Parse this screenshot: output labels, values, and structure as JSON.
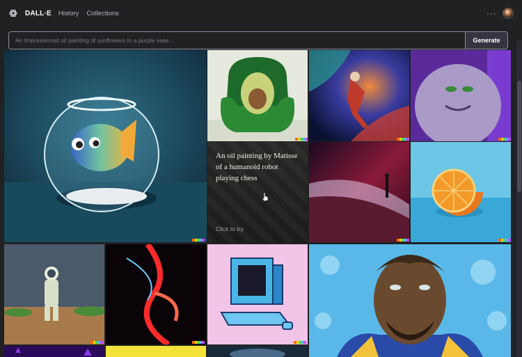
{
  "header": {
    "brand": "DALL·E",
    "nav": [
      {
        "label": "History"
      },
      {
        "label": "Collections"
      }
    ],
    "more_label": "···"
  },
  "search": {
    "placeholder": "An Impressionist oil painting of sunflowers in a purple vase…",
    "button_label": "Generate"
  },
  "prompt_card": {
    "text": "An oil painting by Matisse of a humanoid robot playing chess",
    "cta": "Click to try"
  },
  "gallery": {
    "images": [
      "fishbowl-fish",
      "avocado-armchair",
      "astronaut-space-painting",
      "purple-monster",
      "red-desert-figure",
      "orange-half",
      "astronaut-desert",
      "neon-face",
      "retro-computer",
      "football-player-portrait"
    ]
  },
  "colors": {
    "bg": "#202123",
    "accent": "#343541"
  }
}
